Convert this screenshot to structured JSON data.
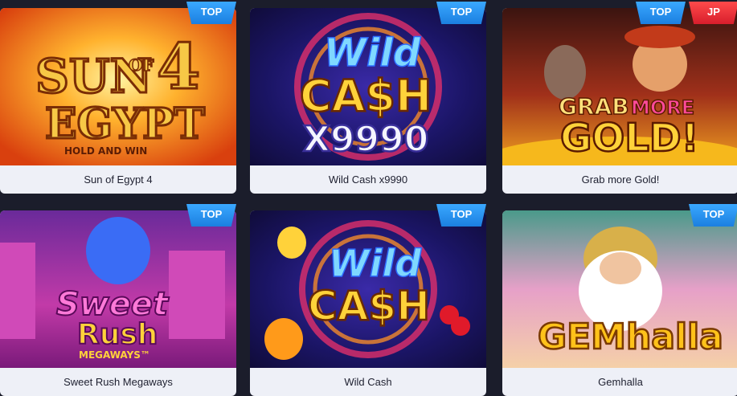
{
  "games": [
    {
      "title": "Sun of Egypt 4",
      "art": {
        "line1": "SUN",
        "line2": "4",
        "line3": "EGYPT",
        "of": "OF",
        "sub": "HOLD AND WIN"
      },
      "badges": [
        "TOP"
      ]
    },
    {
      "title": "Wild Cash x9990",
      "art": {
        "line1": "Wild",
        "line2": "CA$H",
        "line3": "X9990"
      },
      "badges": [
        "TOP"
      ]
    },
    {
      "title": "Grab more Gold!",
      "art": {
        "line1": "GRAB",
        "line1b": "MORE",
        "line2": "GOLD!"
      },
      "badges": [
        "TOP",
        "JP"
      ]
    },
    {
      "title": "Sweet Rush Megaways",
      "art": {
        "line1": "Sweet",
        "line2": "Rush",
        "line3": "MEGAWAYS™"
      },
      "badges": [
        "TOP"
      ]
    },
    {
      "title": "Wild Cash",
      "art": {
        "line1": "Wild",
        "line2": "CA$H"
      },
      "badges": [
        "TOP"
      ]
    },
    {
      "title": "Gemhalla",
      "art": {
        "line1": "GEMhalla"
      },
      "badges": [
        "TOP"
      ]
    }
  ],
  "colors": {
    "background": "#1b1d2b",
    "caption_bg": "#eef0f7",
    "top_badge": "#2a93f5",
    "jp_badge": "#e52533"
  }
}
